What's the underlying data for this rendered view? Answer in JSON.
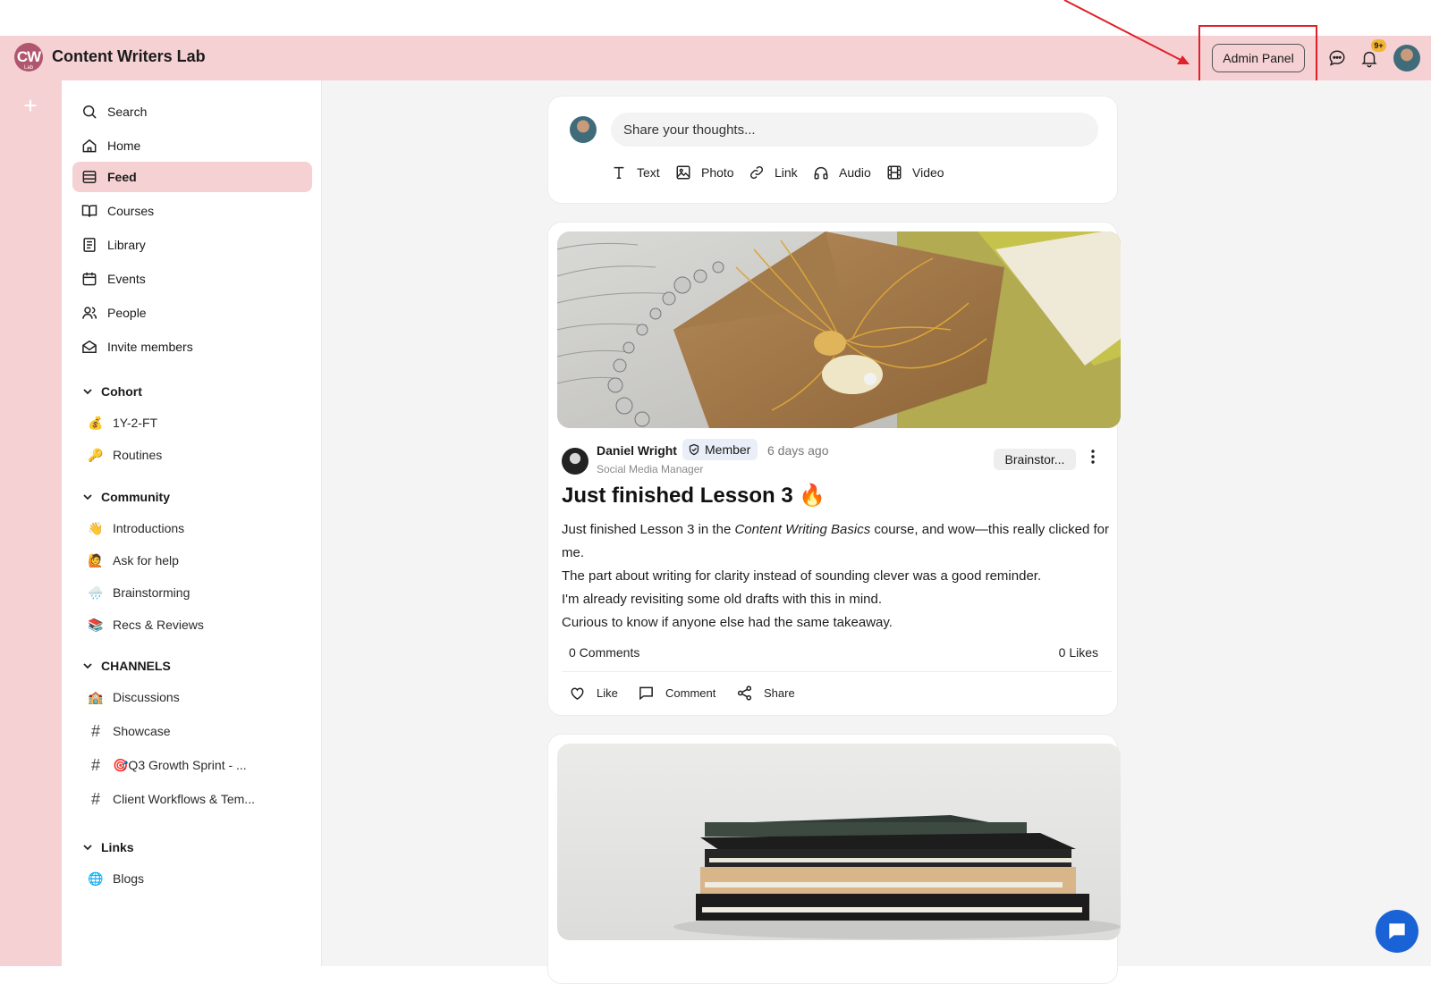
{
  "app": {
    "logo_text": "CW",
    "logo_sub": "Lab",
    "name": "Content Writers Lab"
  },
  "header": {
    "admin_panel_label": "Admin Panel",
    "notification_count": "9+"
  },
  "sidebar": {
    "nav": [
      {
        "label": "Search",
        "icon": "search-icon"
      },
      {
        "label": "Home",
        "icon": "home-icon"
      },
      {
        "label": "Feed",
        "icon": "feed-icon",
        "active": true
      },
      {
        "label": "Courses",
        "icon": "book-open-icon"
      },
      {
        "label": "Library",
        "icon": "library-icon"
      },
      {
        "label": "Events",
        "icon": "calendar-icon"
      },
      {
        "label": "People",
        "icon": "people-icon"
      },
      {
        "label": "Invite members",
        "icon": "envelope-icon"
      }
    ],
    "sections": [
      {
        "title": "Cohort",
        "items": [
          {
            "emoji": "💰",
            "label": "1Y-2-FT"
          },
          {
            "emoji": "🔑",
            "label": "Routines"
          }
        ]
      },
      {
        "title": "Community",
        "items": [
          {
            "emoji": "👋",
            "label": "Introductions"
          },
          {
            "emoji": "🙋",
            "label": "Ask for help"
          },
          {
            "emoji": "🌧️",
            "label": "Brainstorming"
          },
          {
            "emoji": "📚",
            "label": "Recs & Reviews"
          }
        ]
      },
      {
        "title": "CHANNELS",
        "items": [
          {
            "emoji": "🏫",
            "label": "Discussions"
          },
          {
            "emoji": "#",
            "label": "Showcase"
          },
          {
            "emoji": "#",
            "label": "🎯Q3 Growth Sprint - ..."
          },
          {
            "emoji": "#",
            "label": "Client Workflows & Tem..."
          }
        ]
      },
      {
        "title": "Links",
        "items": [
          {
            "emoji": "🌐",
            "label": "Blogs"
          }
        ]
      }
    ]
  },
  "composer": {
    "placeholder": "Share your thoughts...",
    "tools": [
      "Text",
      "Photo",
      "Link",
      "Audio",
      "Video"
    ]
  },
  "post": {
    "author": "Daniel Wright",
    "badge": "Member",
    "time": "6 days ago",
    "role": "Social Media Manager",
    "tag": "Brainstor...",
    "title": "Just finished Lesson 3 🔥",
    "body_1_pre": "Just finished Lesson 3 in the ",
    "body_1_em": "Content Writing Basics",
    "body_1_post": " course, and wow—this really clicked for me.",
    "body_2": "The part about writing for clarity instead of sounding clever was a good reminder.",
    "body_3": "I'm already revisiting some old drafts with this in mind.",
    "body_4": "Curious to know if anyone else had the same takeaway.",
    "comments": "0 Comments",
    "likes": "0 Likes",
    "actions": [
      "Like",
      "Comment",
      "Share"
    ]
  },
  "colors": {
    "accent_pink": "#f6d1d4",
    "annotation_red": "#e0202a",
    "chat_blue": "#1a63d6"
  }
}
